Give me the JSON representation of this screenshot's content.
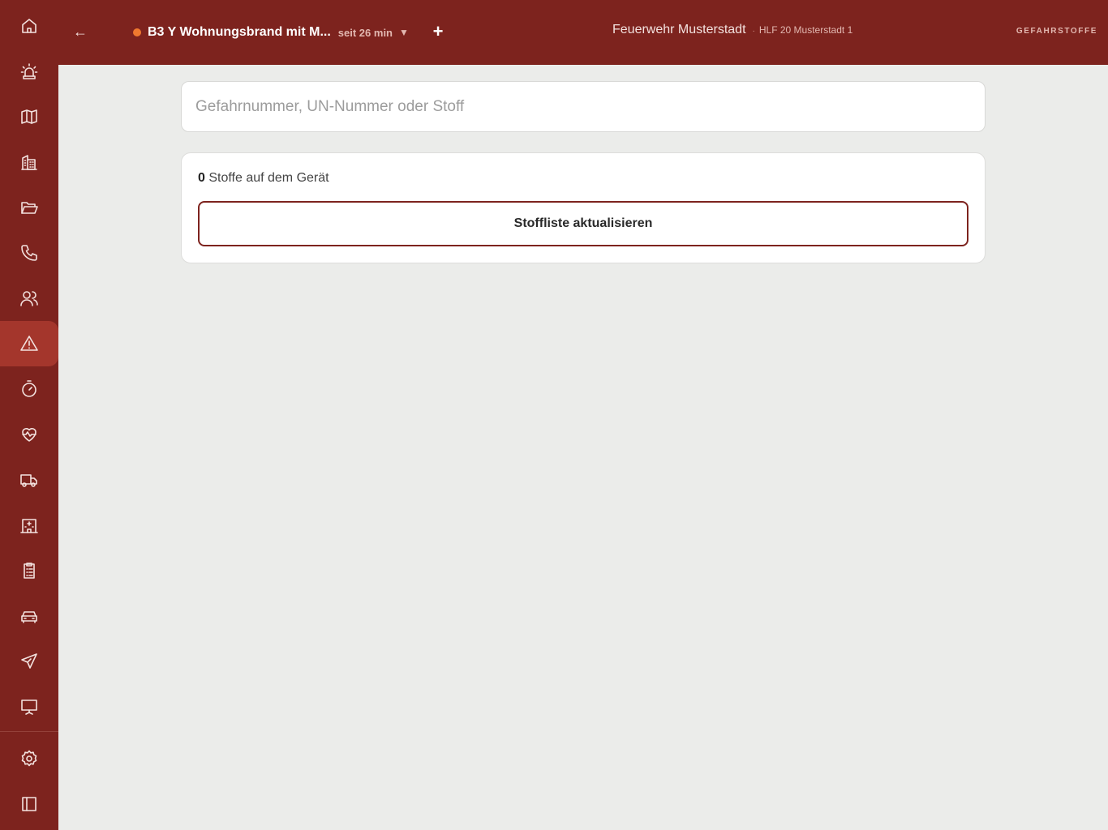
{
  "topbar": {
    "incident_title": "B3 Y Wohnungsbrand mit M...",
    "incident_duration": "seit 26 min",
    "org_name": "Feuerwehr Musterstadt",
    "separator": "·",
    "vehicle_name": "HLF 20 Musterstadt 1",
    "section_label": "GEFAHRSTOFFE"
  },
  "search": {
    "placeholder": "Gefahrnummer, UN-Nummer oder Stoff"
  },
  "substances": {
    "count": "0",
    "count_label": "Stoffe auf dem Gerät",
    "refresh_label": "Stoffliste aktualisieren"
  },
  "sidebar": {
    "items": [
      {
        "icon": "home-icon"
      },
      {
        "icon": "siren-icon"
      },
      {
        "icon": "map-icon"
      },
      {
        "icon": "building-icon"
      },
      {
        "icon": "folder-open-icon"
      },
      {
        "icon": "phone-icon"
      },
      {
        "icon": "users-icon"
      },
      {
        "icon": "warning-icon",
        "active": true
      },
      {
        "icon": "timer-icon"
      },
      {
        "icon": "heart-pulse-icon"
      },
      {
        "icon": "truck-icon"
      },
      {
        "icon": "hospital-icon"
      },
      {
        "icon": "clipboard-icon"
      },
      {
        "icon": "car-icon"
      },
      {
        "icon": "plane-icon"
      },
      {
        "icon": "presentation-icon"
      },
      {
        "icon": "gear-icon"
      },
      {
        "icon": "sidebar-toggle-icon"
      }
    ]
  },
  "colors": {
    "brand": "#7d231e",
    "active_nav": "#a4362c",
    "status_dot": "#f0792f",
    "background": "#ebecea"
  }
}
